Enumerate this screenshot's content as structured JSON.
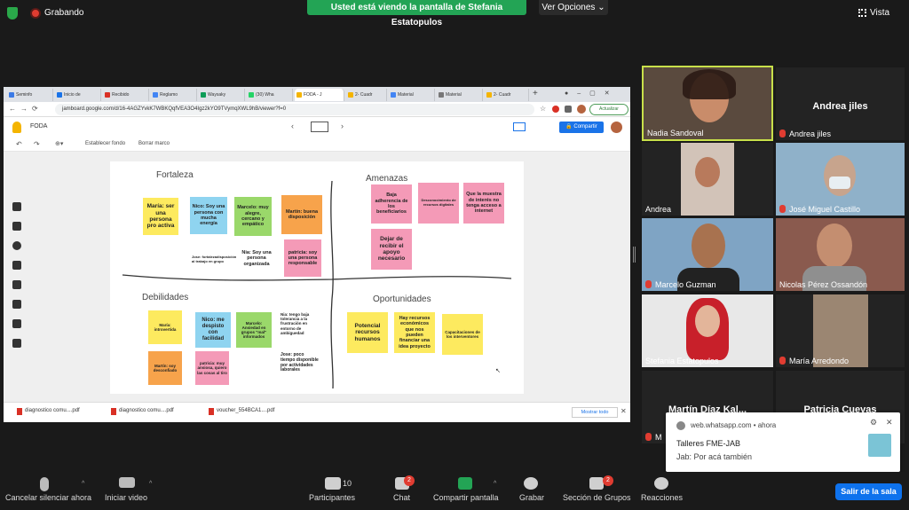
{
  "top": {
    "recording_label": "Grabando",
    "banner": "Usted está viendo la pantalla de Stefania Estatopulos",
    "view_options": "Ver Opciones ⌄",
    "vista": "Vista"
  },
  "browser": {
    "tabs": [
      {
        "label": "Seminfo",
        "color": "#3c7be6"
      },
      {
        "label": "Inicio de",
        "color": "#1a73e8"
      },
      {
        "label": "Recibido",
        "color": "#d93025"
      },
      {
        "label": "Reglamo",
        "color": "#4285f4"
      },
      {
        "label": "Waysaky",
        "color": "#0f9d58"
      },
      {
        "label": "(30) Wha",
        "color": "#25d366"
      },
      {
        "label": "FODA - J",
        "color": "#f4b400"
      },
      {
        "label": "2- Cuadr",
        "color": "#f4b400"
      },
      {
        "label": "Material",
        "color": "#4285f4"
      },
      {
        "label": "Material",
        "color": "#777777"
      },
      {
        "label": "2- Cuadr",
        "color": "#f4b400"
      }
    ],
    "url": "jamboard.google.com/d/16-4AGZYvkK7WBKQqfVEA3O4Igz2kYO9TVymqXWL9hB/viewer?f=0",
    "actualizar": "Actualizar",
    "doc_title": "FODA",
    "compartir": "🔒 Compartir",
    "toolbar": {
      "set_bg": "Establecer fondo",
      "clear": "Borrar marco"
    },
    "downloads": [
      {
        "label": "diagnostico comu....pdf"
      },
      {
        "label": "diagnostico comu....pdf"
      },
      {
        "label": "voucher_554BCA1....pdf"
      }
    ],
    "show_all": "Mostrar todo"
  },
  "board": {
    "headings": {
      "fortaleza": "Fortaleza",
      "amenazas": "Amenazas",
      "debilidades": "Debilidades",
      "oportunidades": "Oportunidades"
    },
    "notes": [
      {
        "text": "María: ser una persona pro activa",
        "color": "#fdea5f"
      },
      {
        "text": "Nico: Soy una persona con mucha energía",
        "color": "#8fd4f0"
      },
      {
        "text": "Marcelo: muy alegre, cercano y empático",
        "color": "#9ad86a"
      },
      {
        "text": "Martín: buena disposición",
        "color": "#f7a34b"
      },
      {
        "text": "patricia: soy una persona responsable",
        "color": "#f49ab7"
      },
      {
        "text": "Baja adherencia de los beneficiarios",
        "color": "#f49ab7"
      },
      {
        "text": "Desconocimiento de recursos digitales",
        "color": "#f49ab7"
      },
      {
        "text": "Que la muestra de interés no tenga acceso a internet",
        "color": "#f49ab7"
      },
      {
        "text": "Dejar de recibir el apoyo necesario",
        "color": "#f49ab7"
      },
      {
        "text": "María: introvertida",
        "color": "#fdea5f"
      },
      {
        "text": "Nico: me despisto con facilidad",
        "color": "#8fd4f0"
      },
      {
        "text": "Marcelo: Ansiedad en grupos \"mal\" informados",
        "color": "#9ad86a"
      },
      {
        "text": "Martín: soy desconfiado",
        "color": "#f7a34b"
      },
      {
        "text": "patricia: muy ansiosa, quiero las cosas al tiro",
        "color": "#f49ab7"
      },
      {
        "text": "Potencial recursos humanos",
        "color": "#fdea5f"
      },
      {
        "text": "Hay recursos económicos que nos pueden financiar una idea proyecto",
        "color": "#fdea5f"
      },
      {
        "text": "Capacitaciones de los interventores",
        "color": "#fdea5f"
      }
    ],
    "loose": [
      {
        "text": "Jose: fortalezadisposición al trabajo en grupo"
      },
      {
        "text": "Nia: Soy una persona organizada"
      },
      {
        "text": "Nia: tengo baja tolerancia a la frustración en entorno de ambiguedad"
      },
      {
        "text": "Jose: poco tiempo disponible por actividades laborales"
      }
    ]
  },
  "participants": [
    {
      "name": "Nadia Sandoval",
      "muted": false
    },
    {
      "name": "Andrea jiles",
      "muted": true,
      "big": "Andrea jiles"
    },
    {
      "name": "Andrea",
      "muted": false
    },
    {
      "name": "José Miguel Castillo",
      "muted": true
    },
    {
      "name": "Marcelo Guzman",
      "muted": true
    },
    {
      "name": "Nicolas Pérez Ossandón",
      "muted": false
    },
    {
      "name": "Stefania Estatopulos",
      "muted": false
    },
    {
      "name": "María Arredondo",
      "muted": true
    },
    {
      "name": "M",
      "muted": true,
      "big": "Martín  Díaz  Kal..."
    },
    {
      "name": "",
      "muted": false,
      "big": "Patricia Cuevas"
    }
  ],
  "notification": {
    "source": "web.whatsapp.com • ahora",
    "title": "Talleres FME-JAB",
    "body": "Jab: Por acá también"
  },
  "bottombar": {
    "unmute": "Cancelar silenciar ahora",
    "video": "Iniciar video",
    "participants": "Participantes",
    "participants_count": "10",
    "chat": "Chat",
    "chat_badge": "2",
    "share": "Compartir pantalla",
    "record": "Grabar",
    "breakout": "Sección de Grupos",
    "breakout_badge": "2",
    "reactions": "Reacciones",
    "leave": "Salir de la sala"
  }
}
